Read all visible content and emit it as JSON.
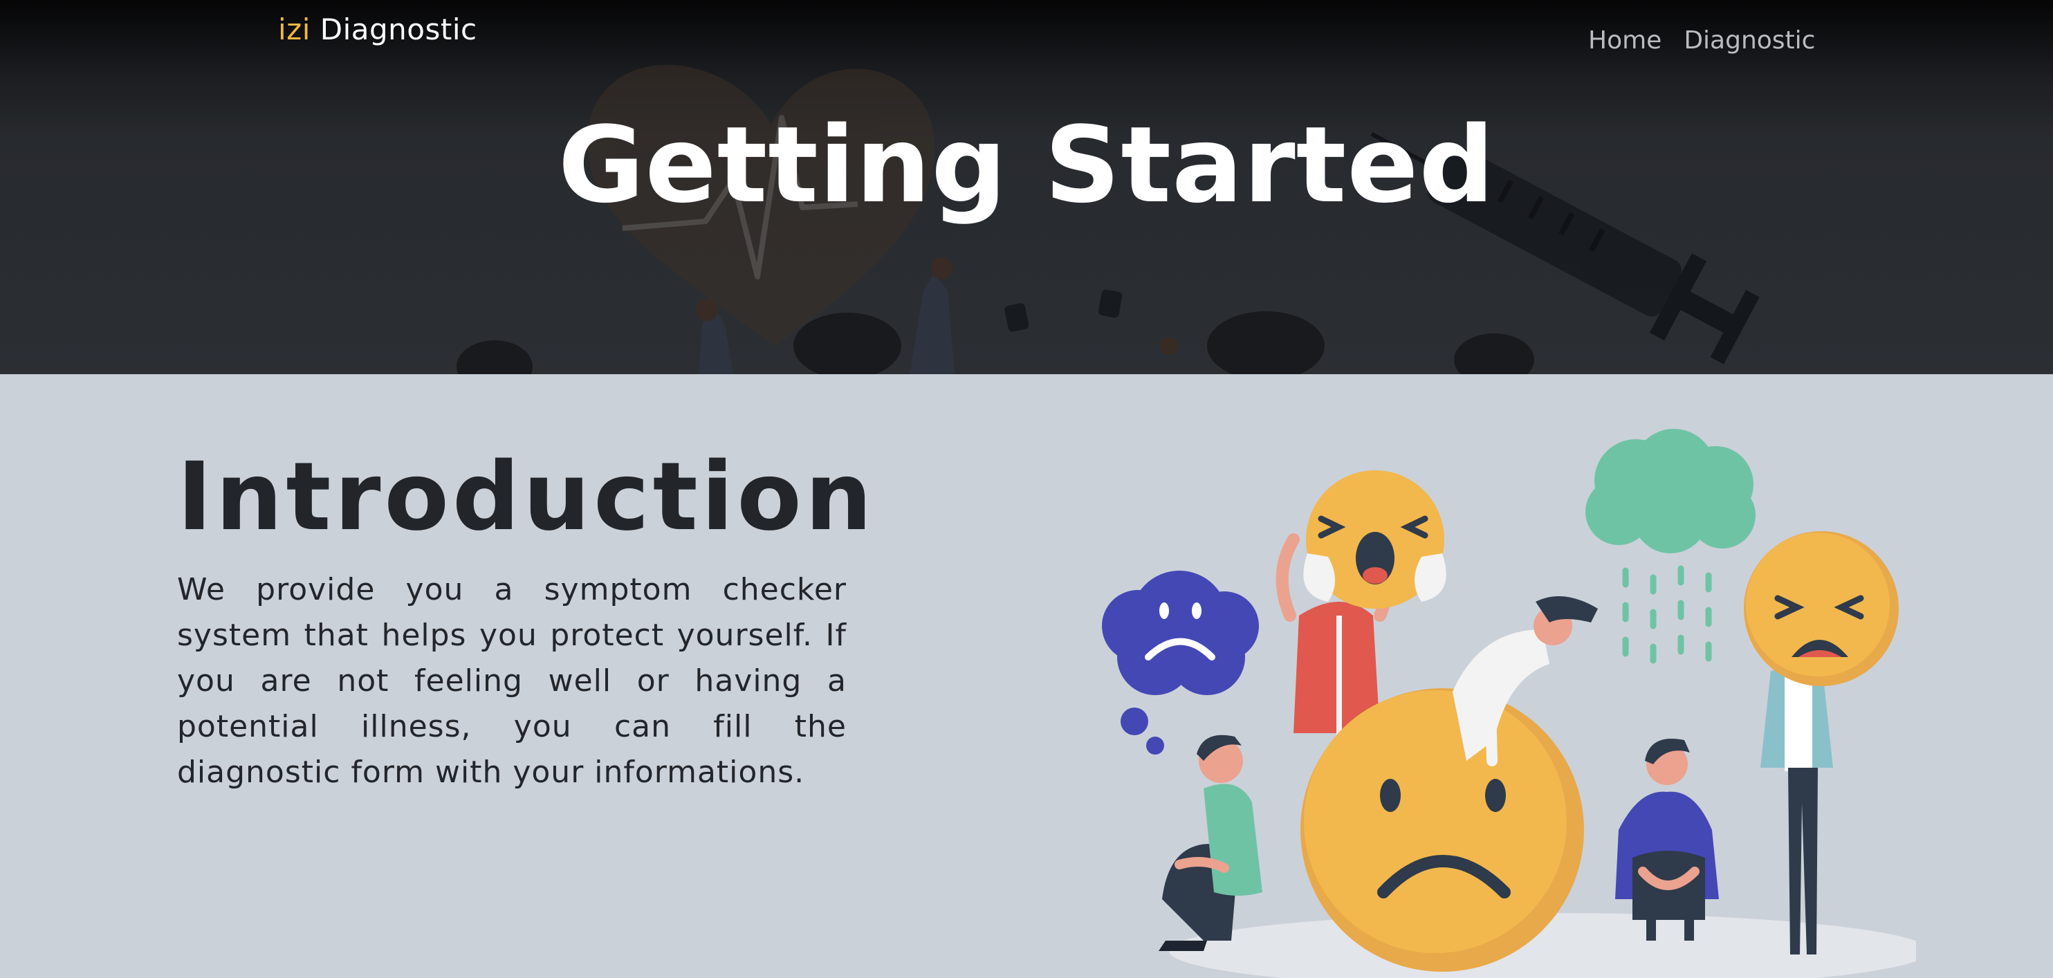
{
  "navbar": {
    "brand_accent": "izi",
    "brand_name": " Diagnostic",
    "links": [
      "Home",
      "Diagnostic"
    ]
  },
  "hero": {
    "title": "Getting Started"
  },
  "intro": {
    "title": "Introduction",
    "text": "We provide you a symptom checker system that helps you protect yourself. If you are not feeling well or having a potential illness, you can fill the diagnostic form with your informations."
  },
  "colors": {
    "accent": "#f1b73f",
    "hero_bg": "#2b2f34",
    "page_bg": "#cbd1d9",
    "text_dark": "#22252a"
  },
  "icons": [
    "heart-pulse-icon",
    "syringe-icon"
  ]
}
